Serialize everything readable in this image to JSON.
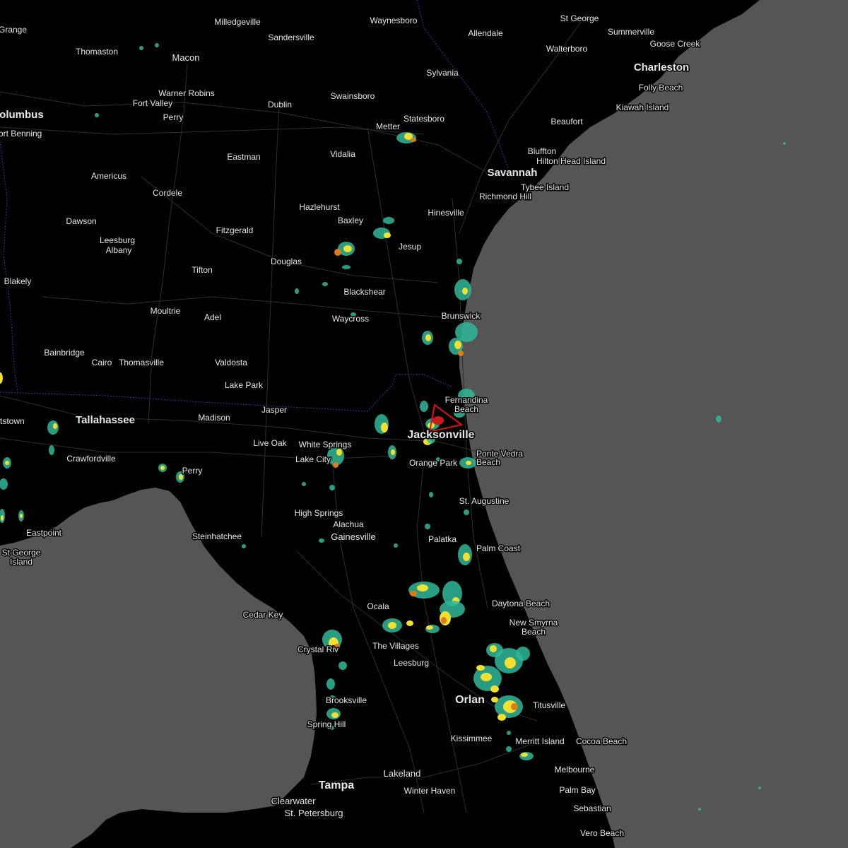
{
  "colors": {
    "water": "#555555",
    "land": "#000000",
    "roads": "#2e2e2e",
    "state_border": "#1f3fb0",
    "radar_light": "#2fb89a",
    "radar_medium": "#f2e030",
    "radar_heavy": "#e07b18",
    "radar_extreme": "#d01818",
    "warning_polygon": "#e01010"
  },
  "cities": [
    {
      "name": "Grange",
      "size": "s"
    },
    {
      "name": "Milledgeville",
      "size": "s"
    },
    {
      "name": "Waynesboro",
      "size": "s"
    },
    {
      "name": "Allendale",
      "size": "s"
    },
    {
      "name": "St George",
      "size": "s"
    },
    {
      "name": "Summerville",
      "size": "s"
    },
    {
      "name": "Goose Creek",
      "size": "s"
    },
    {
      "name": "Charleston",
      "size": "l"
    },
    {
      "name": "Folly Beach",
      "size": "s"
    },
    {
      "name": "Kiawah Island",
      "size": "s"
    },
    {
      "name": "Thomaston",
      "size": "s"
    },
    {
      "name": "Sandersville",
      "size": "s"
    },
    {
      "name": "Macon",
      "size": "m"
    },
    {
      "name": "Walterboro",
      "size": "s"
    },
    {
      "name": "Sylvania",
      "size": "s"
    },
    {
      "name": "Warner Robins",
      "size": "s"
    },
    {
      "name": "Fort Valley",
      "size": "s"
    },
    {
      "name": "Dublin",
      "size": "s"
    },
    {
      "name": "Swainsboro",
      "size": "s"
    },
    {
      "name": "Perry",
      "size": "s"
    },
    {
      "name": "Statesboro",
      "size": "s"
    },
    {
      "name": "Columbus",
      "size": "l"
    },
    {
      "name": "Fort Benning",
      "size": "s"
    },
    {
      "name": "Metter",
      "size": "s"
    },
    {
      "name": "Beaufort",
      "size": "s"
    },
    {
      "name": "Bluffton",
      "size": "s"
    },
    {
      "name": "Hilton Head Island",
      "size": "s"
    },
    {
      "name": "Eastman",
      "size": "s"
    },
    {
      "name": "Vidalia",
      "size": "s"
    },
    {
      "name": "Savannah",
      "size": "l"
    },
    {
      "name": "Americus",
      "size": "s"
    },
    {
      "name": "Tybee Island",
      "size": "s"
    },
    {
      "name": "Cordele",
      "size": "s"
    },
    {
      "name": "Richmond Hill",
      "size": "s"
    },
    {
      "name": "Hazlehurst",
      "size": "s"
    },
    {
      "name": "Hinesville",
      "size": "s"
    },
    {
      "name": "Dawson",
      "size": "s"
    },
    {
      "name": "Baxley",
      "size": "s"
    },
    {
      "name": "Fitzgerald",
      "size": "s"
    },
    {
      "name": "Leesburg",
      "size": "s"
    },
    {
      "name": "Albany",
      "size": "s"
    },
    {
      "name": "Jesup",
      "size": "s"
    },
    {
      "name": "Douglas",
      "size": "s"
    },
    {
      "name": "Tifton",
      "size": "s"
    },
    {
      "name": "Blakely",
      "size": "s"
    },
    {
      "name": "Blackshear",
      "size": "s"
    },
    {
      "name": "Moultrie",
      "size": "s"
    },
    {
      "name": "Brunswick",
      "size": "s"
    },
    {
      "name": "Adel",
      "size": "s"
    },
    {
      "name": "Waycross",
      "size": "s"
    },
    {
      "name": "Bainbridge",
      "size": "s"
    },
    {
      "name": "Cairo",
      "size": "s"
    },
    {
      "name": "Thomasville",
      "size": "s"
    },
    {
      "name": "Valdosta",
      "size": "s"
    },
    {
      "name": "Lake Park",
      "size": "s"
    },
    {
      "name": "Fernandina",
      "size": "s"
    },
    {
      "name": "Beach",
      "size": "s"
    },
    {
      "name": "Jasper",
      "size": "s"
    },
    {
      "name": "Madison",
      "size": "s"
    },
    {
      "name": "Tallahassee",
      "size": "l"
    },
    {
      "name": "ntstown",
      "size": "s"
    },
    {
      "name": "Jacksonville",
      "size": "xl"
    },
    {
      "name": "Live Oak",
      "size": "s"
    },
    {
      "name": "White Springs",
      "size": "s"
    },
    {
      "name": "Ponte Vedra",
      "size": "s"
    },
    {
      "name": "Beach",
      "size": "s"
    },
    {
      "name": "Lake City",
      "size": "s"
    },
    {
      "name": "Orange Park",
      "size": "s"
    },
    {
      "name": "Crawfordville",
      "size": "s"
    },
    {
      "name": "Perry",
      "size": "s"
    },
    {
      "name": "St. Augustine",
      "size": "s"
    },
    {
      "name": "High Springs",
      "size": "s"
    },
    {
      "name": "Alachua",
      "size": "s"
    },
    {
      "name": "Eastpoint",
      "size": "s"
    },
    {
      "name": "Steinhatchee",
      "size": "s"
    },
    {
      "name": "Gainesville",
      "size": "m"
    },
    {
      "name": "Palatka",
      "size": "s"
    },
    {
      "name": "Palm Coast",
      "size": "s"
    },
    {
      "name": "St George",
      "size": "s"
    },
    {
      "name": "Island",
      "size": "s"
    },
    {
      "name": "Daytona Beach",
      "size": "s"
    },
    {
      "name": "Ocala",
      "size": "s"
    },
    {
      "name": "Cedar Key",
      "size": "s"
    },
    {
      "name": "New Smyrna",
      "size": "s"
    },
    {
      "name": "Beach",
      "size": "s"
    },
    {
      "name": "The Villages",
      "size": "s"
    },
    {
      "name": "Crystal Riv",
      "size": "s"
    },
    {
      "name": "Leesburg",
      "size": "s"
    },
    {
      "name": "Orlan",
      "size": "xl"
    },
    {
      "name": "Brooksville",
      "size": "s"
    },
    {
      "name": "Titusville",
      "size": "s"
    },
    {
      "name": "Spring Hill",
      "size": "s"
    },
    {
      "name": "Kissimmee",
      "size": "s"
    },
    {
      "name": "Merritt Island",
      "size": "s"
    },
    {
      "name": "Cocoa Beach",
      "size": "s"
    },
    {
      "name": "Lakeland",
      "size": "m"
    },
    {
      "name": "Melbourne",
      "size": "s"
    },
    {
      "name": "Tampa",
      "size": "xl"
    },
    {
      "name": "Winter Haven",
      "size": "s"
    },
    {
      "name": "Palm Bay",
      "size": "s"
    },
    {
      "name": "Clearwater",
      "size": "m"
    },
    {
      "name": "St. Petersburg",
      "size": "m"
    },
    {
      "name": "Sebastian",
      "size": "s"
    },
    {
      "name": "Vero Beach",
      "size": "s"
    }
  ]
}
